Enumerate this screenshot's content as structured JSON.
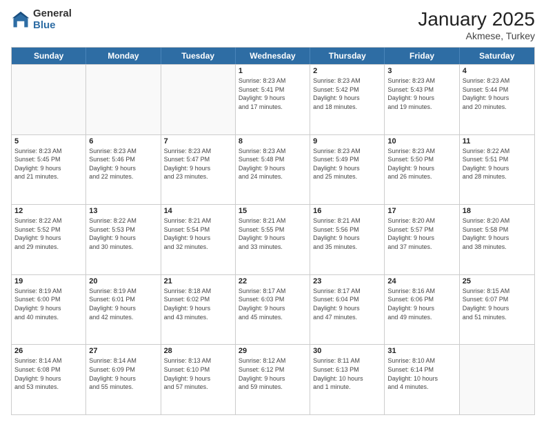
{
  "logo": {
    "general": "General",
    "blue": "Blue"
  },
  "header": {
    "month": "January 2025",
    "location": "Akmese, Turkey"
  },
  "weekdays": [
    "Sunday",
    "Monday",
    "Tuesday",
    "Wednesday",
    "Thursday",
    "Friday",
    "Saturday"
  ],
  "weeks": [
    [
      {
        "day": "",
        "info": ""
      },
      {
        "day": "",
        "info": ""
      },
      {
        "day": "",
        "info": ""
      },
      {
        "day": "1",
        "info": "Sunrise: 8:23 AM\nSunset: 5:41 PM\nDaylight: 9 hours\nand 17 minutes."
      },
      {
        "day": "2",
        "info": "Sunrise: 8:23 AM\nSunset: 5:42 PM\nDaylight: 9 hours\nand 18 minutes."
      },
      {
        "day": "3",
        "info": "Sunrise: 8:23 AM\nSunset: 5:43 PM\nDaylight: 9 hours\nand 19 minutes."
      },
      {
        "day": "4",
        "info": "Sunrise: 8:23 AM\nSunset: 5:44 PM\nDaylight: 9 hours\nand 20 minutes."
      }
    ],
    [
      {
        "day": "5",
        "info": "Sunrise: 8:23 AM\nSunset: 5:45 PM\nDaylight: 9 hours\nand 21 minutes."
      },
      {
        "day": "6",
        "info": "Sunrise: 8:23 AM\nSunset: 5:46 PM\nDaylight: 9 hours\nand 22 minutes."
      },
      {
        "day": "7",
        "info": "Sunrise: 8:23 AM\nSunset: 5:47 PM\nDaylight: 9 hours\nand 23 minutes."
      },
      {
        "day": "8",
        "info": "Sunrise: 8:23 AM\nSunset: 5:48 PM\nDaylight: 9 hours\nand 24 minutes."
      },
      {
        "day": "9",
        "info": "Sunrise: 8:23 AM\nSunset: 5:49 PM\nDaylight: 9 hours\nand 25 minutes."
      },
      {
        "day": "10",
        "info": "Sunrise: 8:23 AM\nSunset: 5:50 PM\nDaylight: 9 hours\nand 26 minutes."
      },
      {
        "day": "11",
        "info": "Sunrise: 8:22 AM\nSunset: 5:51 PM\nDaylight: 9 hours\nand 28 minutes."
      }
    ],
    [
      {
        "day": "12",
        "info": "Sunrise: 8:22 AM\nSunset: 5:52 PM\nDaylight: 9 hours\nand 29 minutes."
      },
      {
        "day": "13",
        "info": "Sunrise: 8:22 AM\nSunset: 5:53 PM\nDaylight: 9 hours\nand 30 minutes."
      },
      {
        "day": "14",
        "info": "Sunrise: 8:21 AM\nSunset: 5:54 PM\nDaylight: 9 hours\nand 32 minutes."
      },
      {
        "day": "15",
        "info": "Sunrise: 8:21 AM\nSunset: 5:55 PM\nDaylight: 9 hours\nand 33 minutes."
      },
      {
        "day": "16",
        "info": "Sunrise: 8:21 AM\nSunset: 5:56 PM\nDaylight: 9 hours\nand 35 minutes."
      },
      {
        "day": "17",
        "info": "Sunrise: 8:20 AM\nSunset: 5:57 PM\nDaylight: 9 hours\nand 37 minutes."
      },
      {
        "day": "18",
        "info": "Sunrise: 8:20 AM\nSunset: 5:58 PM\nDaylight: 9 hours\nand 38 minutes."
      }
    ],
    [
      {
        "day": "19",
        "info": "Sunrise: 8:19 AM\nSunset: 6:00 PM\nDaylight: 9 hours\nand 40 minutes."
      },
      {
        "day": "20",
        "info": "Sunrise: 8:19 AM\nSunset: 6:01 PM\nDaylight: 9 hours\nand 42 minutes."
      },
      {
        "day": "21",
        "info": "Sunrise: 8:18 AM\nSunset: 6:02 PM\nDaylight: 9 hours\nand 43 minutes."
      },
      {
        "day": "22",
        "info": "Sunrise: 8:17 AM\nSunset: 6:03 PM\nDaylight: 9 hours\nand 45 minutes."
      },
      {
        "day": "23",
        "info": "Sunrise: 8:17 AM\nSunset: 6:04 PM\nDaylight: 9 hours\nand 47 minutes."
      },
      {
        "day": "24",
        "info": "Sunrise: 8:16 AM\nSunset: 6:06 PM\nDaylight: 9 hours\nand 49 minutes."
      },
      {
        "day": "25",
        "info": "Sunrise: 8:15 AM\nSunset: 6:07 PM\nDaylight: 9 hours\nand 51 minutes."
      }
    ],
    [
      {
        "day": "26",
        "info": "Sunrise: 8:14 AM\nSunset: 6:08 PM\nDaylight: 9 hours\nand 53 minutes."
      },
      {
        "day": "27",
        "info": "Sunrise: 8:14 AM\nSunset: 6:09 PM\nDaylight: 9 hours\nand 55 minutes."
      },
      {
        "day": "28",
        "info": "Sunrise: 8:13 AM\nSunset: 6:10 PM\nDaylight: 9 hours\nand 57 minutes."
      },
      {
        "day": "29",
        "info": "Sunrise: 8:12 AM\nSunset: 6:12 PM\nDaylight: 9 hours\nand 59 minutes."
      },
      {
        "day": "30",
        "info": "Sunrise: 8:11 AM\nSunset: 6:13 PM\nDaylight: 10 hours\nand 1 minute."
      },
      {
        "day": "31",
        "info": "Sunrise: 8:10 AM\nSunset: 6:14 PM\nDaylight: 10 hours\nand 4 minutes."
      },
      {
        "day": "",
        "info": ""
      }
    ]
  ]
}
